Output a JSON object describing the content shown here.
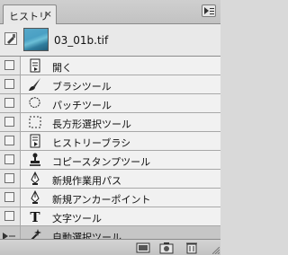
{
  "panel": {
    "tab_label": "ヒストリー",
    "tab_close": "×"
  },
  "snapshot": {
    "name": "03_01b.tif"
  },
  "history_items": [
    {
      "label": "開く",
      "icon": "open-document-icon"
    },
    {
      "label": "ブラシツール",
      "icon": "brush-icon"
    },
    {
      "label": "パッチツール",
      "icon": "patch-icon"
    },
    {
      "label": "長方形選択ツール",
      "icon": "rect-marquee-icon"
    },
    {
      "label": "ヒストリーブラシ",
      "icon": "history-brush-icon"
    },
    {
      "label": "コピースタンプツール",
      "icon": "clone-stamp-icon"
    },
    {
      "label": "新規作業用パス",
      "icon": "pen-icon"
    },
    {
      "label": "新規アンカーポイント",
      "icon": "pen-icon"
    },
    {
      "label": "文字ツール",
      "icon": "type-icon"
    },
    {
      "label": "自動選択ツール",
      "icon": "magic-wand-icon",
      "selected": true
    }
  ],
  "colors": {
    "selected_row": "#c6c6c6",
    "row": "#f1f1f1"
  }
}
